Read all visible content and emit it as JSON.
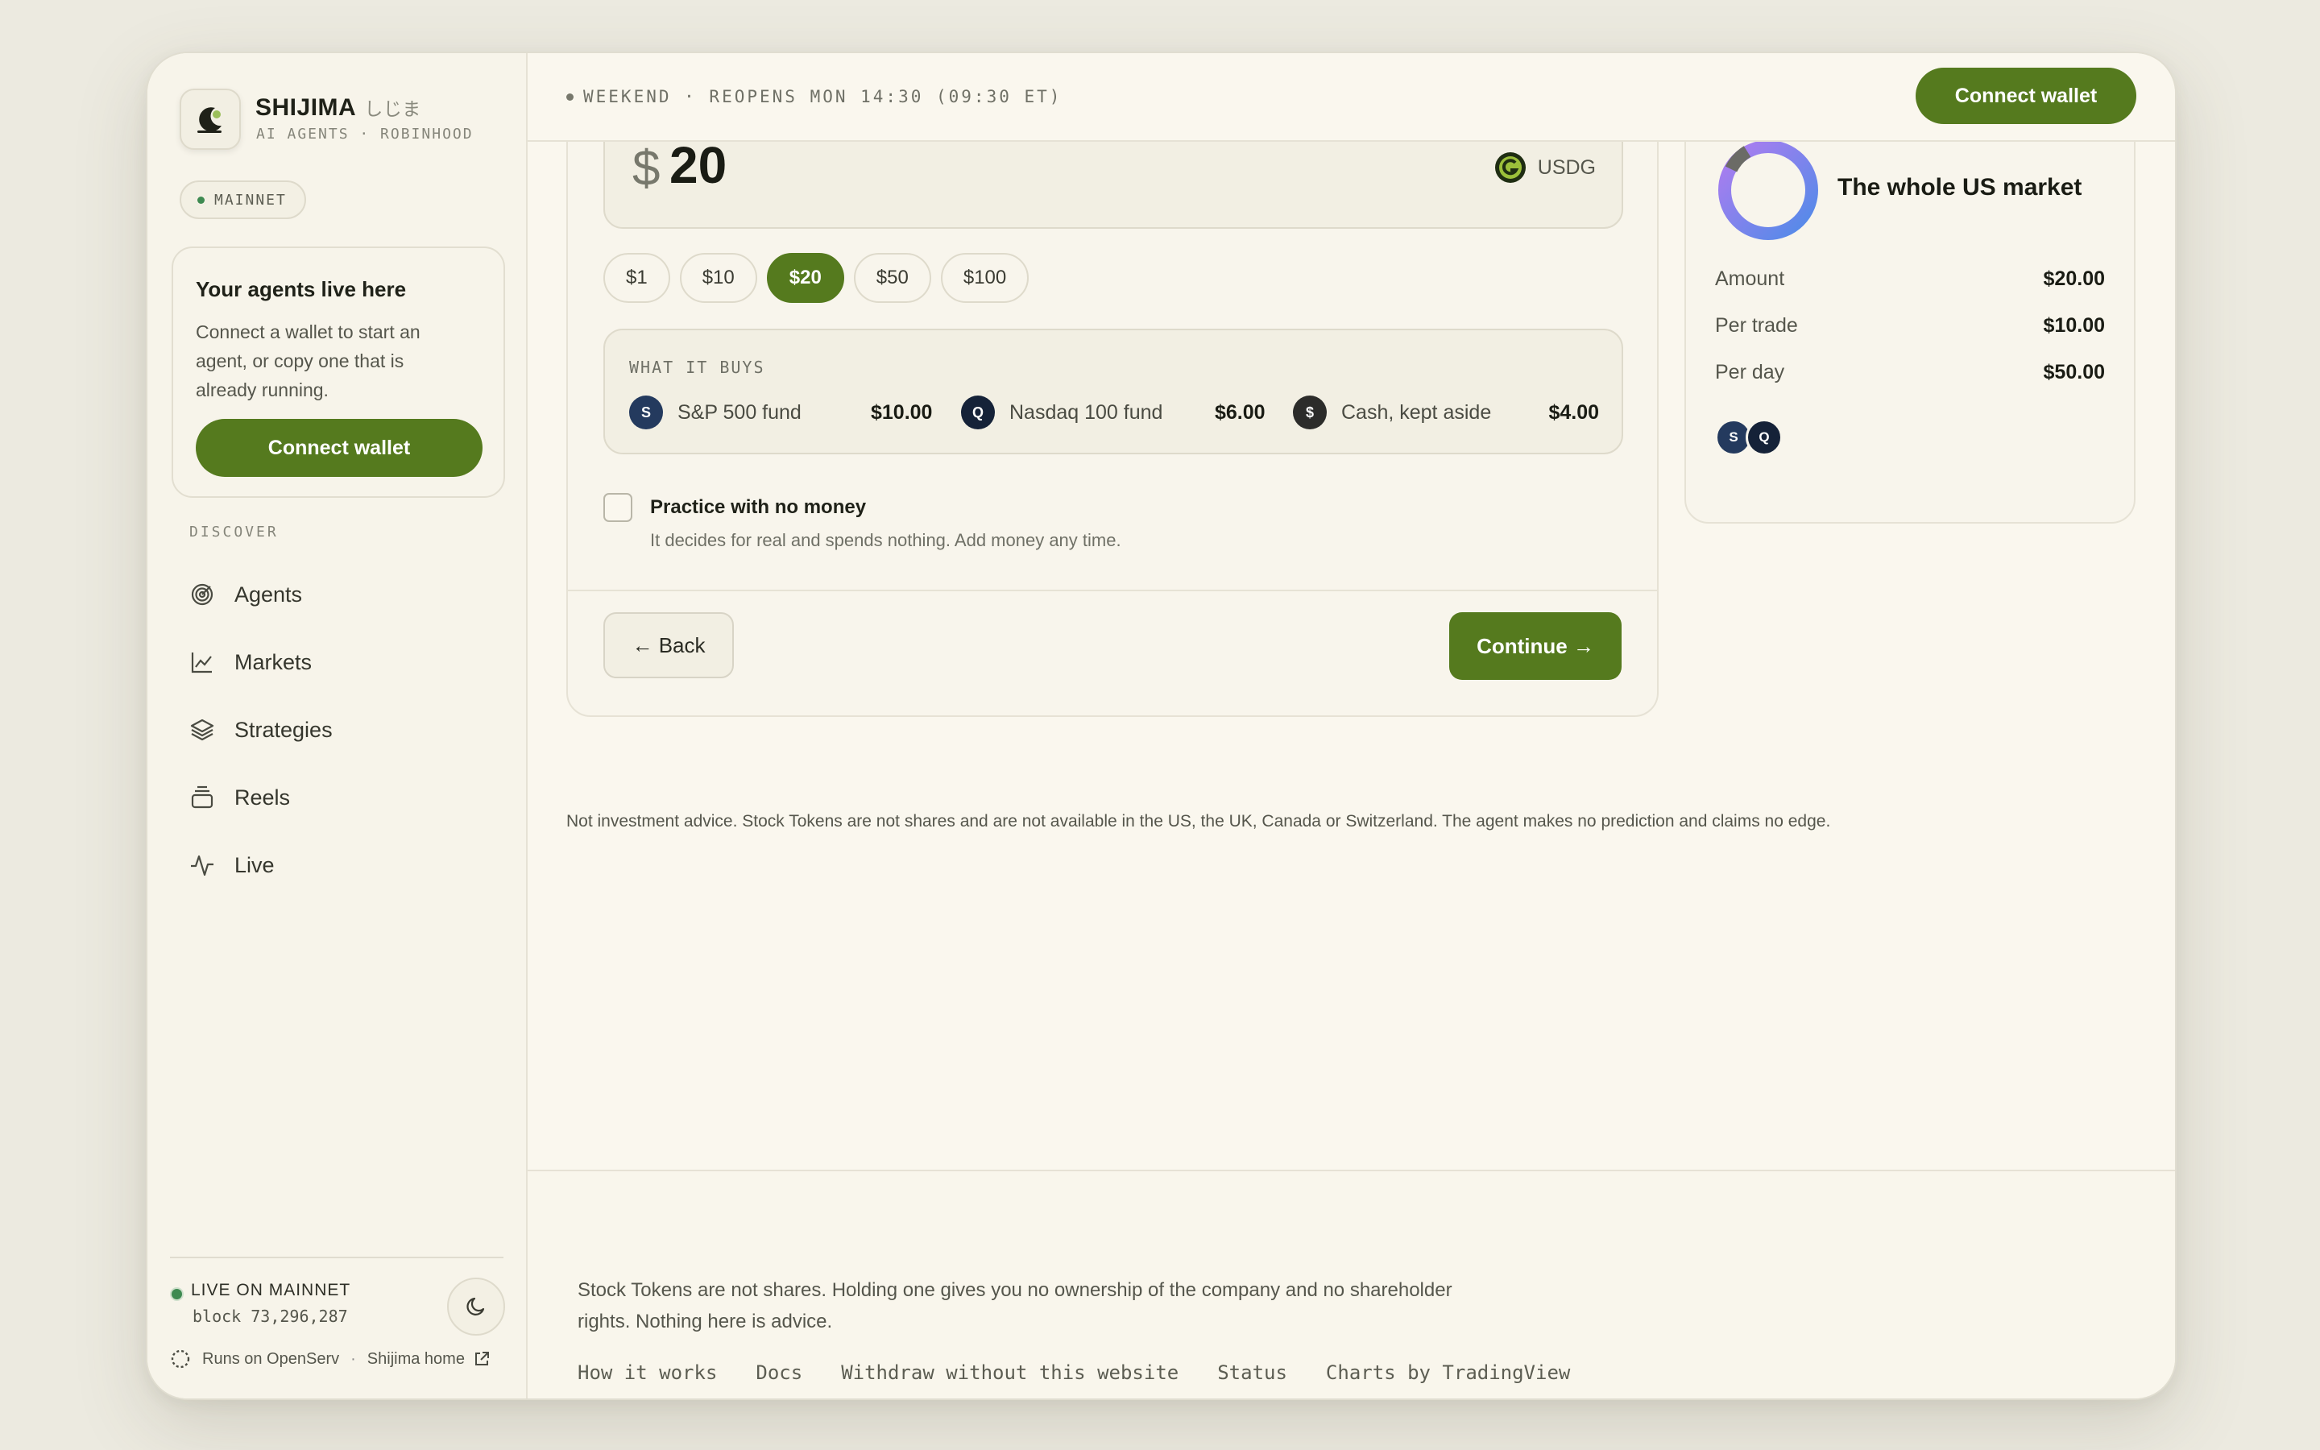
{
  "brand": {
    "name": "SHIJIMA",
    "jp": "しじま",
    "subtitle": "AI AGENTS · ROBINHOOD",
    "network": "MAINNET"
  },
  "sidebar": {
    "card": {
      "title": "Your agents live here",
      "body": "Connect a wallet to start an agent, or copy one that is already running.",
      "button": "Connect wallet"
    },
    "section_label": "DISCOVER",
    "nav": [
      {
        "label": "Agents",
        "icon": "radar-icon"
      },
      {
        "label": "Markets",
        "icon": "line-chart-icon"
      },
      {
        "label": "Strategies",
        "icon": "layers-icon"
      },
      {
        "label": "Reels",
        "icon": "stack-icon"
      },
      {
        "label": "Live",
        "icon": "pulse-icon"
      }
    ],
    "status": {
      "live": "LIVE ON MAINNET",
      "block": "block 73,296,287"
    },
    "runs_on": "Runs on OpenServ",
    "home_link": "Shijima home"
  },
  "topbar": {
    "market_status": "WEEKEND · REOPENS MON 14:30 (09:30 ET)",
    "connect_button": "Connect wallet"
  },
  "setup": {
    "currency_symbol": "$",
    "amount": "20",
    "token": "USDG",
    "presets": [
      "$1",
      "$10",
      "$20",
      "$50",
      "$100"
    ],
    "selected_preset": "$20",
    "buys_label": "WHAT IT BUYS",
    "allocations": [
      {
        "badge": "S",
        "name": "S&P 500 fund",
        "amount": "$10.00",
        "color": "#243a5e"
      },
      {
        "badge": "Q",
        "name": "Nasdaq 100 fund",
        "amount": "$6.00",
        "color": "#152238"
      },
      {
        "badge": "$",
        "name": "Cash, kept aside",
        "amount": "$4.00",
        "color": "#2c2c2a"
      }
    ],
    "practice": {
      "title": "Practice with no money",
      "subtitle": "It decides for real and spends nothing. Add money any time.",
      "checked": false
    },
    "back_button": "← Back",
    "continue_button": "Continue →"
  },
  "disclaimer": "Not investment advice. Stock Tokens are not shares and are not available in the US, the UK, Canada or Switzerland. The agent makes no prediction and claims no edge.",
  "summary": {
    "title": "The whole US market",
    "rows": [
      {
        "label": "Amount",
        "value": "$20.00"
      },
      {
        "label": "Per trade",
        "value": "$10.00"
      },
      {
        "label": "Per day",
        "value": "$50.00"
      }
    ],
    "badges": [
      "S",
      "Q"
    ]
  },
  "footer": {
    "note": "Stock Tokens are not shares. Holding one gives you no ownership of the company and no shareholder rights. Nothing here is advice.",
    "links": [
      "How it works",
      "Docs",
      "Withdraw without this website",
      "Status",
      "Charts by TradingView"
    ]
  },
  "colors": {
    "accent": "#557a1e",
    "background": "#faf7ee",
    "live": "#3e8a51"
  }
}
